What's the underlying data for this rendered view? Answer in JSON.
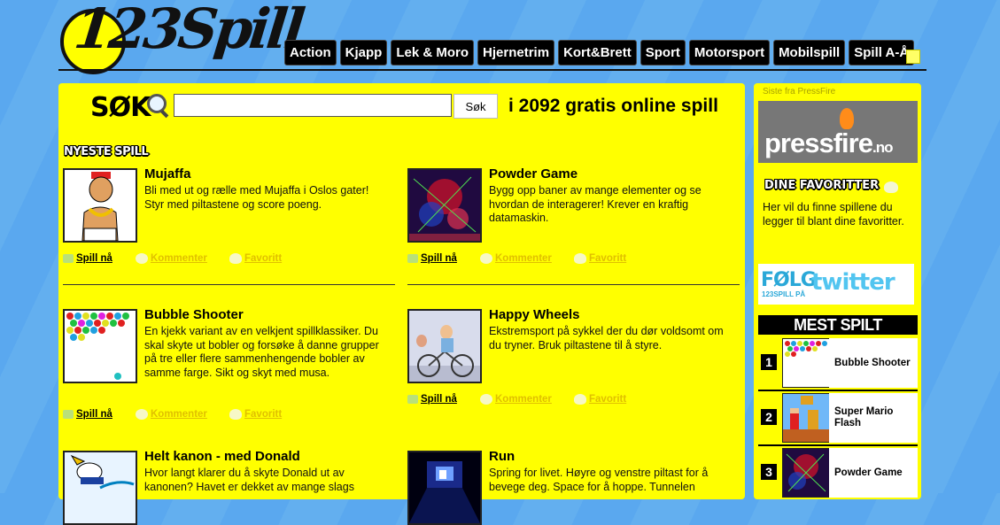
{
  "logo": {
    "text": "123Spill"
  },
  "nav": [
    "Action",
    "Kjapp",
    "Lek & Moro",
    "Hjernetrim",
    "Kort&Brett",
    "Sport",
    "Motorsport",
    "Mobilspill",
    "Spill A-Å"
  ],
  "search": {
    "heading": "SØK",
    "value": "",
    "button": "Søk",
    "tagline": "i 2092 gratis online spill"
  },
  "newest_heading": "NYESTE SPILL",
  "actions": {
    "play": "Spill nå",
    "comment": "Kommenter",
    "favorite": "Favoritt"
  },
  "games": [
    {
      "title": "Mujaffa",
      "desc": "Bli med ut og rælle med Mujaffa i Oslos gater! Styr med piltastene og score poeng.",
      "thumb": "mujaffa"
    },
    {
      "title": "Powder Game",
      "desc": "Bygg opp baner av mange elementer og se hvordan de interagerer! Krever en kraftig datamaskin.",
      "thumb": "powder"
    },
    {
      "title": "Bubble Shooter",
      "desc": "En kjekk variant av en velkjent spillklassiker. Du skal skyte ut bobler og forsøke å danne grupper på tre eller flere sammenhengende bobler av samme farge. Sikt og skyt med musa.",
      "thumb": "bubble"
    },
    {
      "title": "Happy Wheels",
      "desc": "Ekstremsport på sykkel der du dør voldsomt om du tryner. Bruk piltastene til å styre.",
      "thumb": "wheels"
    },
    {
      "title": "Helt kanon - med Donald",
      "desc": "Hvor langt klarer du å skyte Donald ut av kanonen? Havet er dekket av mange slags",
      "thumb": "donald"
    },
    {
      "title": "Run",
      "desc": "Spring for livet. Høyre og venstre piltast for å bevege deg. Space for å hoppe. Tunnelen",
      "thumb": "run"
    }
  ],
  "sidebar": {
    "latest_from": "Siste fra PressFire",
    "pressfire_logo": "pressfire",
    "pressfire_suffix": ".no",
    "fav_heading": "DINE FAVORITTER",
    "fav_text": "Her vil du finne spillene du legger til blant dine favoritter.",
    "twitter_follow": "FØLG",
    "twitter_sub": "123SPILL PÅ",
    "twitter_word": "twitter",
    "most_heading": "MEST SPILT",
    "most": [
      {
        "rank": "1",
        "name": "Bubble Shooter",
        "thumb": "bubble"
      },
      {
        "rank": "2",
        "name": "Super Mario Flash",
        "thumb": "mario"
      },
      {
        "rank": "3",
        "name": "Powder Game",
        "thumb": "powder"
      }
    ]
  },
  "colors": {
    "panel": "#ffff00",
    "background": "#5aa8ef",
    "nav": "#000000"
  }
}
